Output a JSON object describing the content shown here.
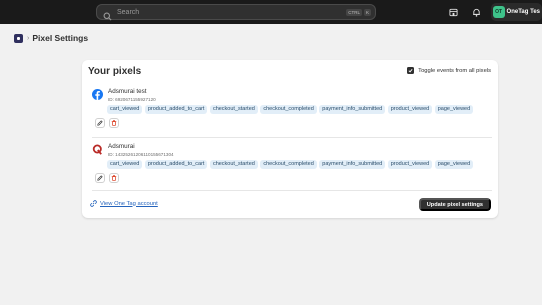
{
  "topbar": {
    "search_placeholder": "Search",
    "shortcut_keys": [
      "CTRL",
      "K"
    ],
    "icons": [
      "search-icon",
      "store-icon",
      "bell-icon"
    ],
    "store": {
      "initials": "OT",
      "name": "OneTag Tes"
    }
  },
  "breadcrumb": {
    "app_icon": "app-icon",
    "separator": "›",
    "title": "Pixel Settings"
  },
  "card": {
    "title": "Your pixels",
    "toggle_all_label": "Toggle events from all pixels",
    "toggle_all_checked": true,
    "pixels": [
      {
        "logo": "facebook-icon",
        "name": "Adsmurai test",
        "id": "ID: 6920671155927120",
        "events": [
          "cart_viewed",
          "product_added_to_cart",
          "checkout_started",
          "checkout_completed",
          "payment_info_submitted",
          "product_viewed",
          "page_viewed"
        ]
      },
      {
        "logo": "quora-icon",
        "name": "Adsmurai",
        "id": "ID: 14325261206110155671304",
        "events": [
          "cart_viewed",
          "product_added_to_cart",
          "checkout_started",
          "checkout_completed",
          "payment_info_submitted",
          "product_viewed",
          "page_viewed"
        ]
      }
    ],
    "view_link": "View One Tag account",
    "update_button": "Update pixel settings"
  },
  "colors": {
    "accent": "#303030",
    "link": "#2463bc",
    "chip_bg": "#e2eef8",
    "delete": "#d72c0d",
    "facebook": "#1877f2",
    "quora": "#b92b27"
  }
}
